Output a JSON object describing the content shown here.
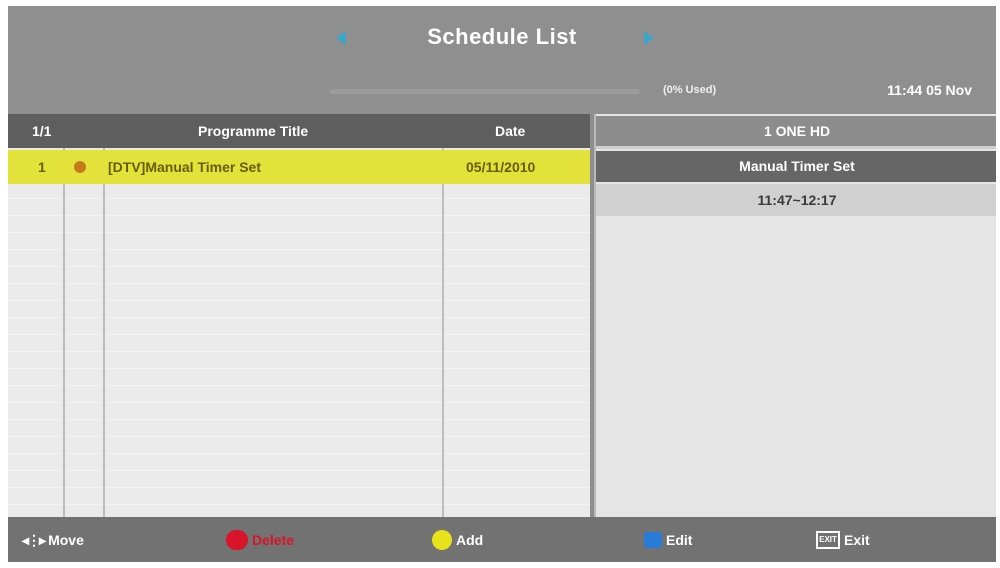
{
  "header": {
    "title": "Schedule List",
    "usage": "(0% Used)",
    "clock": "11:44 05 Nov"
  },
  "table": {
    "columns": {
      "index": "1/1",
      "title": "Programme Title",
      "date": "Date"
    },
    "rows": [
      {
        "index": "1",
        "title": "[DTV]Manual Timer Set",
        "date": "05/11/2010",
        "selected": true
      }
    ]
  },
  "detail": {
    "channel": "1 ONE HD",
    "event": "Manual Timer Set",
    "time": "11:47~12:17"
  },
  "footer": {
    "move": "Move",
    "delete": "Delete",
    "add": "Add",
    "edit": "Edit",
    "exit": "Exit"
  },
  "colors": {
    "selection": "#e3e23a",
    "red": "#d8132a",
    "yellow": "#e8e21a",
    "blue": "#2a7ad8"
  },
  "icons": [
    "left-arrow-icon",
    "right-arrow-icon",
    "record-dot-icon",
    "move-icon",
    "exit-icon"
  ]
}
